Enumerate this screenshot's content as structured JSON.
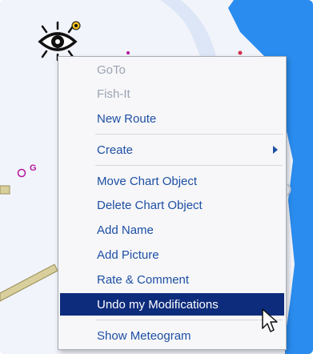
{
  "colors": {
    "map_land": "#f2f4fb",
    "map_water": "#2a8cee",
    "menu_text": "#1d4fa3",
    "menu_disabled": "#9aa3b3",
    "menu_highlight": "#0e2c7c"
  },
  "map": {
    "poi_label": "G"
  },
  "icons": [
    "eye-icon",
    "submenu-arrow-icon",
    "mouse-cursor-icon"
  ],
  "context_menu": {
    "items": [
      {
        "label": "GoTo",
        "enabled": false
      },
      {
        "label": "Fish-It",
        "enabled": false
      },
      {
        "label": "New Route",
        "enabled": true
      },
      {
        "label": "Create",
        "enabled": true,
        "submenu": true
      },
      {
        "label": "Move Chart Object",
        "enabled": true
      },
      {
        "label": "Delete Chart Object",
        "enabled": true
      },
      {
        "label": "Add Name",
        "enabled": true
      },
      {
        "label": "Add Picture",
        "enabled": true
      },
      {
        "label": "Rate & Comment",
        "enabled": true
      },
      {
        "label": "Undo my Modifications",
        "enabled": true,
        "highlighted": true
      },
      {
        "label": "Show Meteogram",
        "enabled": true
      }
    ]
  }
}
